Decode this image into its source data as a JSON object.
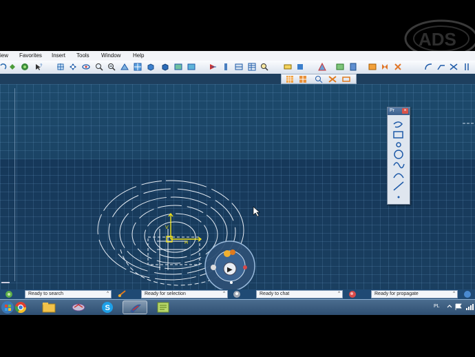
{
  "menu": {
    "items": [
      {
        "label": "iew"
      },
      {
        "label": "Favorites"
      },
      {
        "label": "Insert"
      },
      {
        "label": "Tools"
      },
      {
        "label": "Window"
      },
      {
        "label": "Help"
      }
    ]
  },
  "palette": {
    "title": "Pr",
    "close": "×",
    "tools": [
      "sketch-icon",
      "rectangle-icon",
      "point-icon",
      "circle-icon",
      "spline-icon",
      "arc-icon",
      "line-icon",
      "axis-icon"
    ]
  },
  "statusbar": {
    "fields": [
      {
        "text": "Ready to search",
        "arrow": "^"
      },
      {
        "text": "Ready for selection",
        "arrow": "^"
      },
      {
        "text": "Ready to chat",
        "arrow": "^"
      },
      {
        "text": "Ready for propagate",
        "arrow": "^"
      }
    ]
  },
  "taskbar": {
    "apps": [
      "windows-start-icon",
      "chrome-icon",
      "explorer-icon",
      "app-icon",
      "skype-icon",
      "catia-icon",
      "notes-icon"
    ],
    "tray_lang": "PL"
  },
  "compass": {
    "play_symbol": "▶"
  },
  "colors": {
    "canvas": "#1b4465",
    "grid": "#78aad7",
    "sketch_lines": "#e8eef5",
    "axis_yellow": "#f2e21a"
  }
}
